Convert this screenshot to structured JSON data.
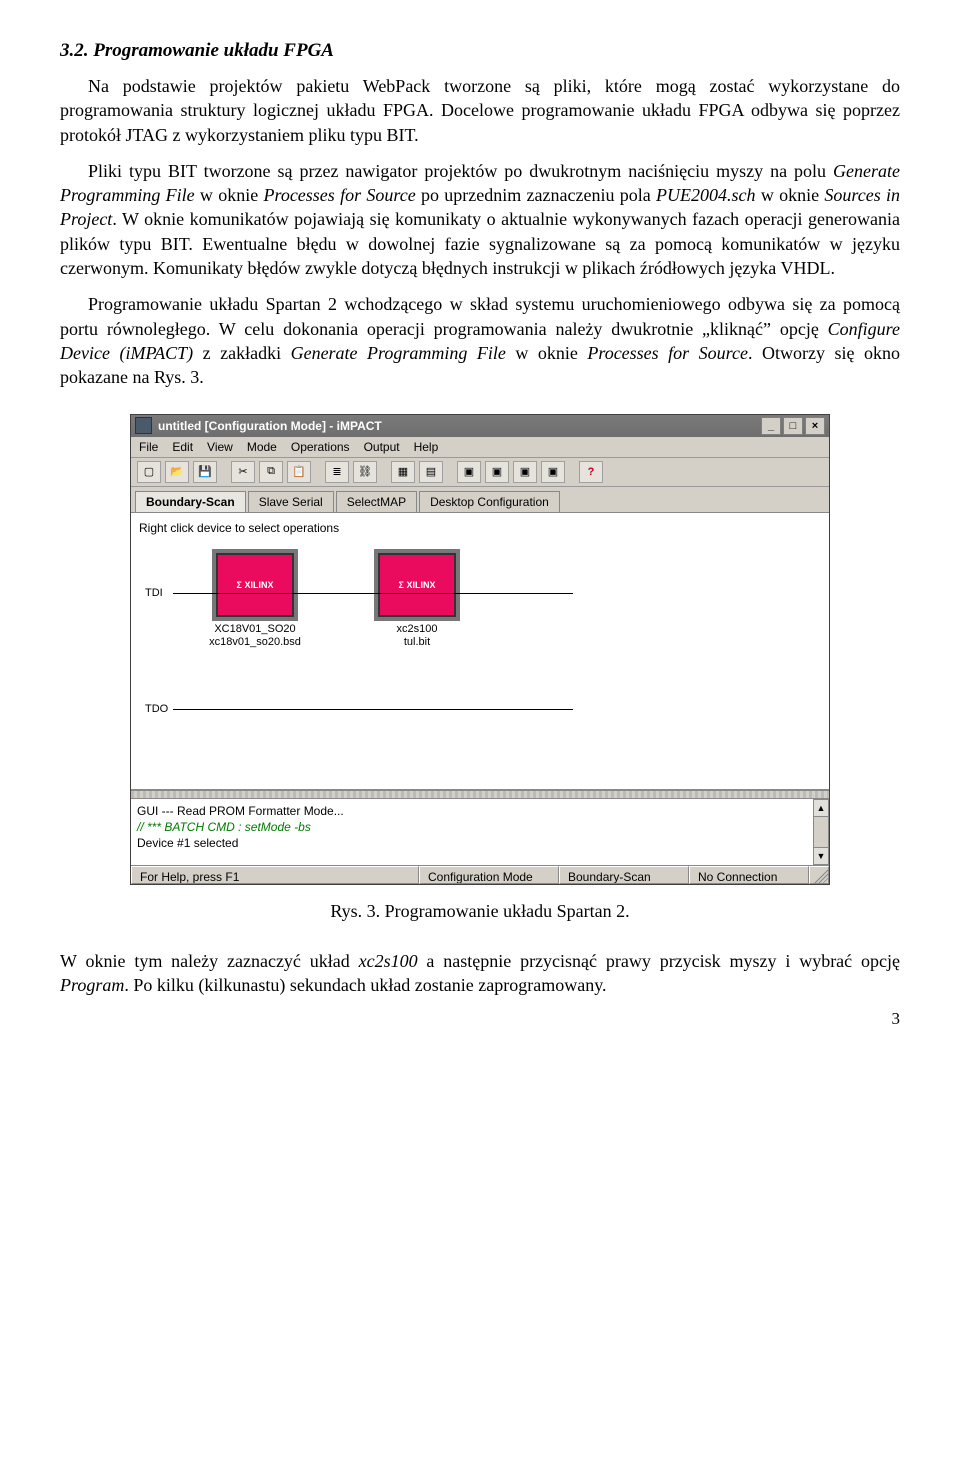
{
  "heading": "3.2.   Programowanie układu FPGA",
  "p1": "Na podstawie projektów pakietu WebPack tworzone są pliki, które mogą zostać wykorzystane do programowania struktury logicznej układu FPGA. Docelowe programowanie układu FPGA odbywa się poprzez protokół JTAG z wykorzystaniem pliku typu BIT.",
  "p2a": "Pliki typu BIT tworzone są przez nawigator projektów po dwukrotnym naciśnięciu myszy na polu ",
  "p2b": "Generate Programming File",
  "p2c": " w oknie ",
  "p2d": "Processes for Source",
  "p2e": " po uprzednim zaznaczeniu pola ",
  "p2f": "PUE2004.sch",
  "p2g": " w oknie ",
  "p2h": "Sources in Project",
  "p2i": ". W oknie komunikatów pojawiają się komunikaty o aktualnie wykonywanych fazach operacji generowania plików typu BIT. Ewentualne błędu w dowolnej fazie sygnalizowane są za pomocą komunikatów w języku czerwonym. Komunikaty błędów zwykle dotyczą błędnych instrukcji w plikach źródłowych języka VHDL.",
  "p3a": "Programowanie układu Spartan 2 wchodzącego w skład systemu uruchomieniowego odbywa się za pomocą portu równoległego. W celu dokonania operacji programowania należy dwukrotnie „kliknąć” opcję ",
  "p3b": "Configure Device (iMPACT)",
  "p3c": " z zakładki ",
  "p3d": "Generate Programming File",
  "p3e": " w oknie ",
  "p3f": "Processes for Source",
  "p3g": ". Otworzy się okno pokazane na Rys. 3.",
  "caption": "Rys. 3. Programowanie układu Spartan 2.",
  "p4a": "W oknie tym należy zaznaczyć układ ",
  "p4b": "xc2s100",
  "p4c": " a następnie przycisnąć prawy przycisk myszy i wybrać opcję ",
  "p4d": "Program",
  "p4e": ". Po kilku (kilkunastu) sekundach układ zostanie zaprogramowany.",
  "pagenum": "3",
  "impact": {
    "title": "untitled [Configuration Mode]  -  iMPACT",
    "winbtns": {
      "min": "_",
      "max": "□",
      "close": "×"
    },
    "menus": [
      "File",
      "Edit",
      "View",
      "Mode",
      "Operations",
      "Output",
      "Help"
    ],
    "toolbar_icons": [
      "new-icon",
      "open-icon",
      "save-icon",
      "cut-icon",
      "copy-icon",
      "paste-icon",
      "db-icon",
      "chain1-icon",
      "chain2-icon",
      "grid1-icon",
      "grid2-icon",
      "grid3-icon",
      "chip1-icon",
      "chip2-icon",
      "chip3-icon",
      "chip4-icon",
      "help-icon"
    ],
    "tabs": [
      "Boundary-Scan",
      "Slave Serial",
      "SelectMAP",
      "Desktop Configuration"
    ],
    "hint": "Right click device to select operations",
    "tdi": "TDI",
    "tdo": "TDO",
    "chiplogo": "Σ XILINX",
    "chip1": {
      "l1": "XC18V01_SO20",
      "l2": "xc18v01_so20.bsd"
    },
    "chip2": {
      "l1": "xc2s100",
      "l2": "tul.bit"
    },
    "log": {
      "l1": "GUI --- Read PROM Formatter Mode...",
      "l2": "// *** BATCH CMD : setMode -bs",
      "l3": "Device #1 selected"
    },
    "status": {
      "help": "For Help, press F1",
      "mode": "Configuration Mode",
      "scan": "Boundary-Scan",
      "conn": "No Connection"
    }
  }
}
